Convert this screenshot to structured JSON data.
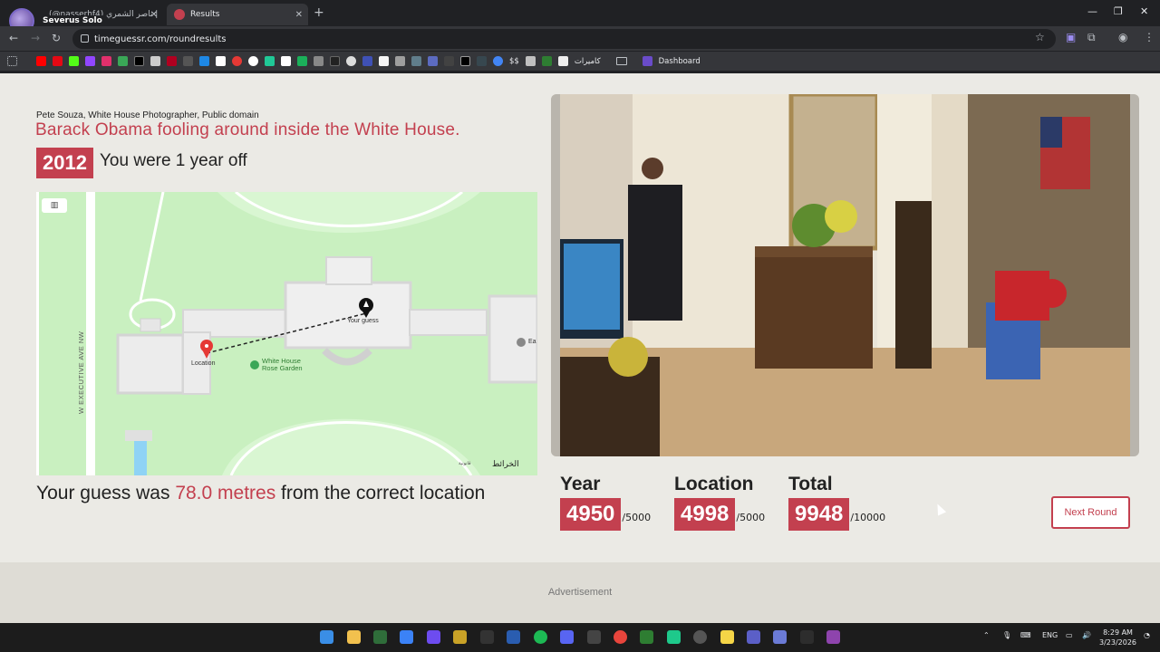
{
  "browser": {
    "tabs": [
      {
        "label": "(@nasserhf4) ناصر الشمري |"
      },
      {
        "label": "Results"
      }
    ],
    "profile_tooltip": "Severus Solo",
    "url": "timeguessr.com/roundresults",
    "bookmarks": {
      "text_items": [
        "$$",
        "كاميرات",
        "Dashboard"
      ]
    }
  },
  "round": {
    "credit": "Pete Souza, White House Photographer, Public domain",
    "title": "Barack Obama fooling around inside the White House.",
    "year": "2012",
    "year_result": "You were 1 year off"
  },
  "map": {
    "street_label": "W EXECUTIVE AVE NW",
    "location_label": "Location",
    "guess_label": "Your guess",
    "garden_label": "White House Rose Garden",
    "edge_label": "Ea",
    "attribution": "الخرائط",
    "attribution_small": "قانونية"
  },
  "distance": {
    "prefix": "Your guess was ",
    "value": "78.0 metres",
    "suffix": " from the correct location"
  },
  "scores": {
    "year": {
      "label": "Year",
      "value": "4950",
      "max": "/5000"
    },
    "location": {
      "label": "Location",
      "value": "4998",
      "max": "/5000"
    },
    "total": {
      "label": "Total",
      "value": "9948",
      "max": "/10000"
    }
  },
  "next_button": "Next Round",
  "advertisement": "Advertisement",
  "taskbar": {
    "language": "ENG",
    "time": "8:29 AM",
    "date": "3/23/2026"
  },
  "colors": {
    "accent": "#c3404f",
    "page_bg": "#ebeae5",
    "map_green": "#c9f0c0"
  }
}
